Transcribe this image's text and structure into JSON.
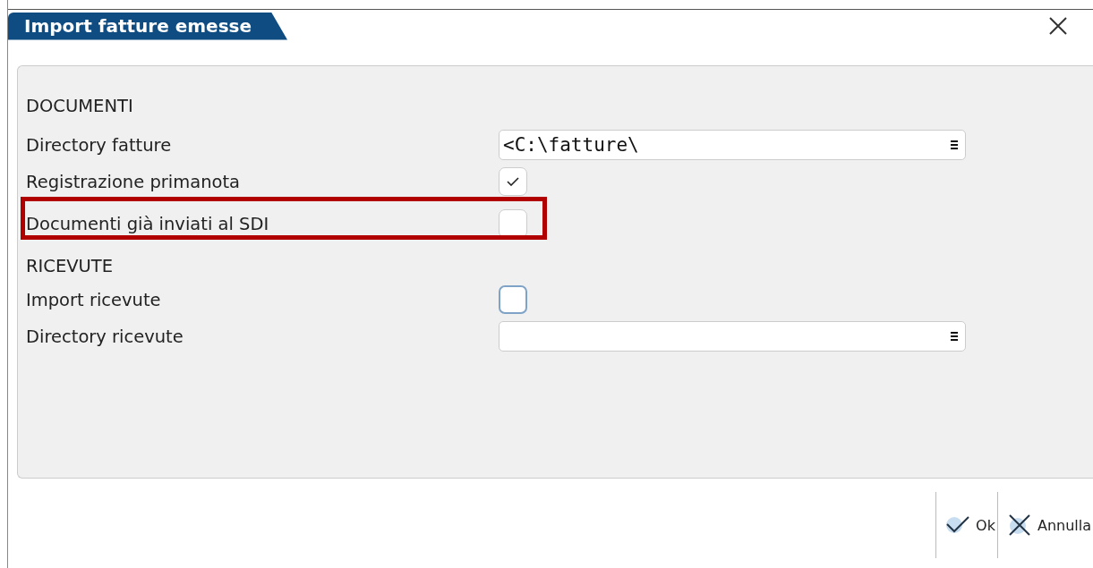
{
  "window": {
    "title": "Import fatture emesse"
  },
  "rows": [
    {
      "kind": "section",
      "label": "DOCUMENTI"
    },
    {
      "kind": "path",
      "label": "Directory fatture",
      "value": "<C:\\fatture\\"
    },
    {
      "kind": "checkbox",
      "label": "Registrazione primanota",
      "checked": true,
      "focused": false,
      "highlighted": false
    },
    {
      "kind": "checkbox",
      "label": "Documenti già inviati al SDI",
      "checked": false,
      "focused": false,
      "highlighted": true
    },
    {
      "kind": "section",
      "label": "RICEVUTE"
    },
    {
      "kind": "checkbox",
      "label": "Import ricevute",
      "checked": false,
      "focused": true,
      "highlighted": false
    },
    {
      "kind": "path",
      "label": "Directory ricevute",
      "value": ""
    }
  ],
  "buttons": [
    {
      "kind": "ok",
      "label": "Ok"
    },
    {
      "kind": "cancel",
      "label": "Annulla"
    }
  ]
}
